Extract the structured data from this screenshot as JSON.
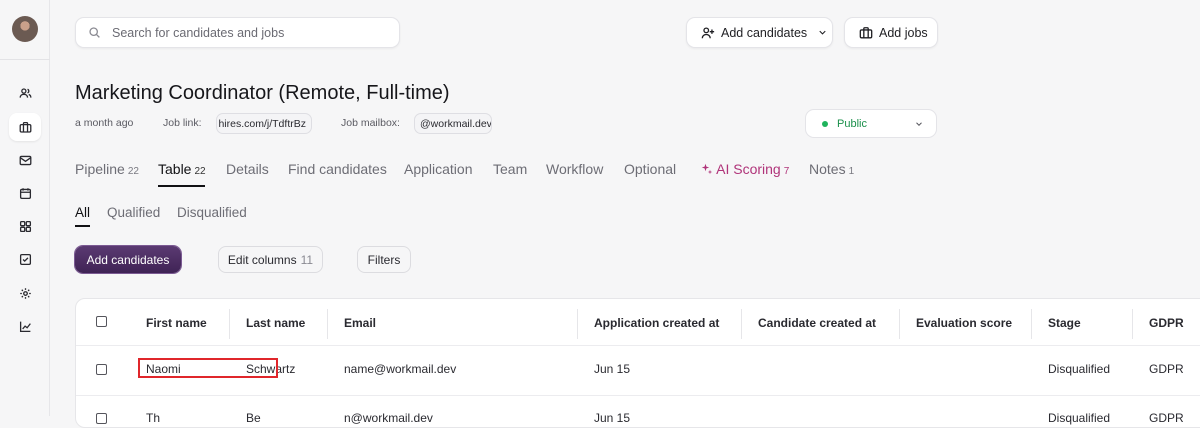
{
  "colors": {
    "accent": "#4a2d60",
    "ai_scoring": "#b0347a",
    "public_status": "#1fb35c",
    "highlight": "#e0262b"
  },
  "sidebar": {
    "items": [
      {
        "name": "users-icon"
      },
      {
        "name": "briefcase-icon",
        "active": true
      },
      {
        "name": "mail-icon"
      },
      {
        "name": "calendar-icon"
      },
      {
        "name": "dashboard-icon"
      },
      {
        "name": "checklist-icon"
      },
      {
        "name": "settings-icon"
      },
      {
        "name": "reports-icon"
      }
    ]
  },
  "search": {
    "placeholder": "Search for candidates and jobs"
  },
  "header": {
    "add_candidates": "Add candidates",
    "add_jobs": "Add jobs"
  },
  "job": {
    "title": "Marketing Coordinator (Remote, Full-time)",
    "posted": "a month ago",
    "job_link_label": "Job link:",
    "job_link_value": "hires.com/j/TdftrBz",
    "mailbox_label": "Job mailbox:",
    "mailbox_value": "@workmail.dev",
    "visibility": "Public"
  },
  "tabs": [
    {
      "label": "Pipeline",
      "count": "22"
    },
    {
      "label": "Table",
      "count": "22",
      "active": true
    },
    {
      "label": "Details",
      "count": ""
    },
    {
      "label": "Find candidates",
      "count": ""
    },
    {
      "label": "Application",
      "count": ""
    },
    {
      "label": "Team",
      "count": ""
    },
    {
      "label": "Workflow",
      "count": ""
    },
    {
      "label": "Optional",
      "count": ""
    },
    {
      "label": "AI Scoring",
      "count": "7"
    },
    {
      "label": "Notes",
      "count": "1"
    }
  ],
  "subtabs": [
    "All",
    "Qualified",
    "Disqualified"
  ],
  "toolbar": {
    "add_candidates": "Add candidates",
    "edit_columns": "Edit columns",
    "edit_columns_count": "11",
    "filters": "Filters"
  },
  "table": {
    "columns": [
      "First name",
      "Last name",
      "Email",
      "Application created at",
      "Candidate created at",
      "Evaluation score",
      "Stage",
      "GDPR"
    ],
    "rows": [
      {
        "first": "Naomi",
        "last": "Schwartz",
        "email": "name@workmail.dev",
        "app_created": "Jun 15",
        "cand_created": "",
        "score": "",
        "stage": "Disqualified",
        "gdpr": "GDPR"
      },
      {
        "first": "Th",
        "last": "Be",
        "email": "n@workmail.dev",
        "app_created": "Jun 15",
        "cand_created": "",
        "score": "",
        "stage": "Disqualified",
        "gdpr": "GDPR"
      }
    ]
  }
}
